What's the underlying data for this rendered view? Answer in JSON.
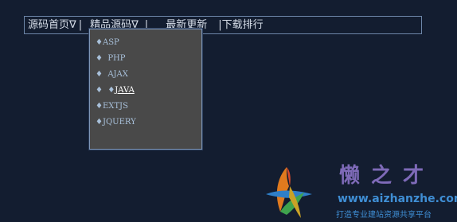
{
  "nav": {
    "items": [
      {
        "label": "源码首页∇"
      },
      {
        "label": "精品源码∇"
      },
      {
        "label": "最新更新"
      },
      {
        "label": "下载排行"
      }
    ],
    "separator": "|"
  },
  "dropdown": {
    "items": [
      {
        "prefix": "♦",
        "label": "ASP",
        "active": false
      },
      {
        "prefix": "♦  ",
        "label": "PHP",
        "active": false
      },
      {
        "prefix": "♦  ",
        "label": "AJAX",
        "active": false
      },
      {
        "prefix": "♦  ♦",
        "label": "JAVA",
        "active": true
      },
      {
        "prefix": "♦",
        "label": "EXTJS",
        "active": false
      },
      {
        "prefix": "♦",
        "label": "JQUERY",
        "active": false
      }
    ]
  },
  "watermark": {
    "title": "懒之才",
    "url": "www.aizhanzhe.com",
    "slogan": "打造专业建站资源共享平台",
    "colors": {
      "title": "#7e6ab8",
      "url": "#3f8ed4"
    }
  },
  "colors": {
    "background": "#131d30",
    "nav_border": "#6d86a8",
    "dropdown_bg": "#494949",
    "dropdown_text": "#a8c0da"
  }
}
